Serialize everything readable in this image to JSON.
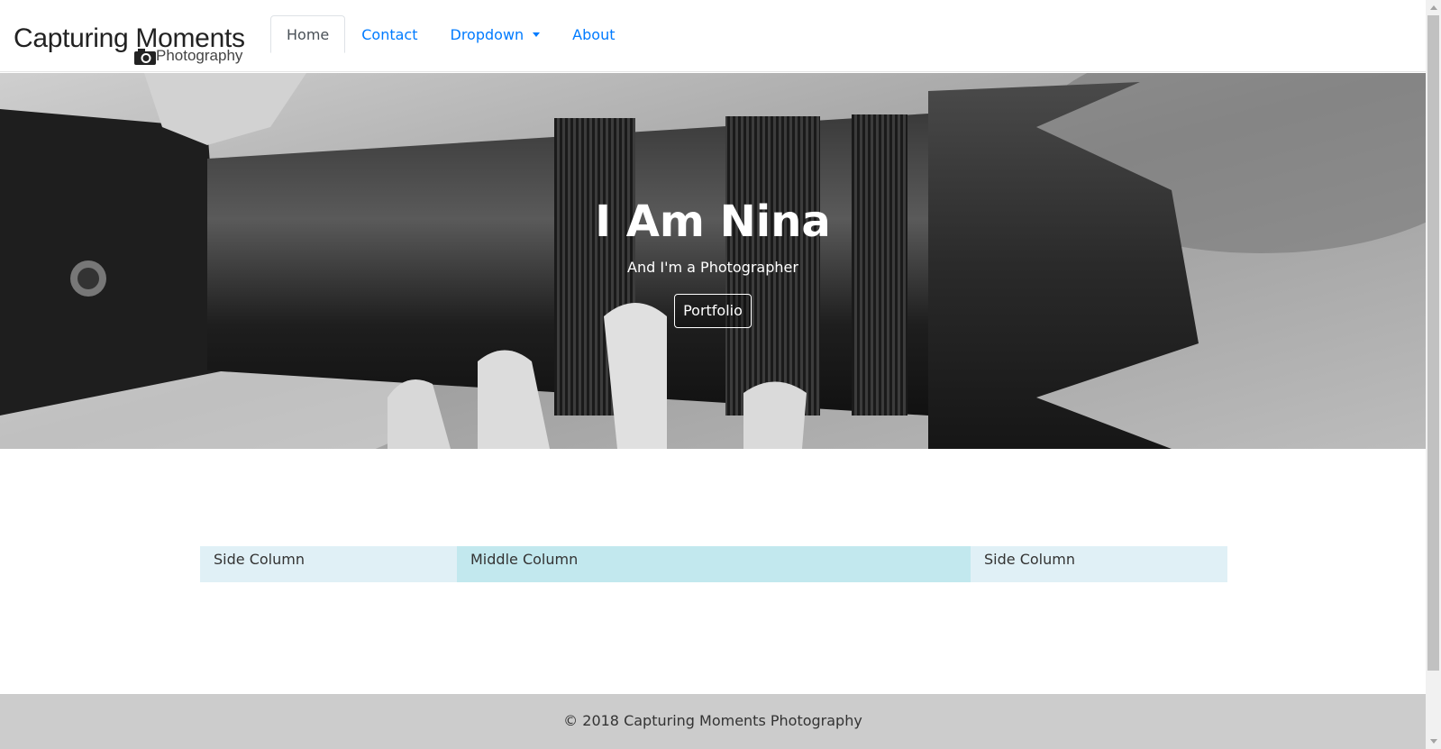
{
  "brand": {
    "title": "Capturing Moments",
    "subtitle": "Photography",
    "icon": "camera-icon"
  },
  "nav": {
    "items": [
      {
        "label": "Home",
        "active": true
      },
      {
        "label": "Contact",
        "active": false
      },
      {
        "label": "Dropdown",
        "active": false
      },
      {
        "label": "About",
        "active": false
      }
    ]
  },
  "hero": {
    "title": "I Am Nina",
    "subtitle": "And I'm a Photographer",
    "button_label": "Portfolio"
  },
  "columns": {
    "left": "Side Column",
    "middle": "Middle Column",
    "right": "Side Column"
  },
  "footer": {
    "text": "© 2018 Capturing Moments Photography"
  },
  "colors": {
    "link": "#007bff",
    "side_column_bg": "#e0f0f6",
    "middle_column_bg": "#c2e8ee",
    "footer_bg": "#cccccc"
  }
}
